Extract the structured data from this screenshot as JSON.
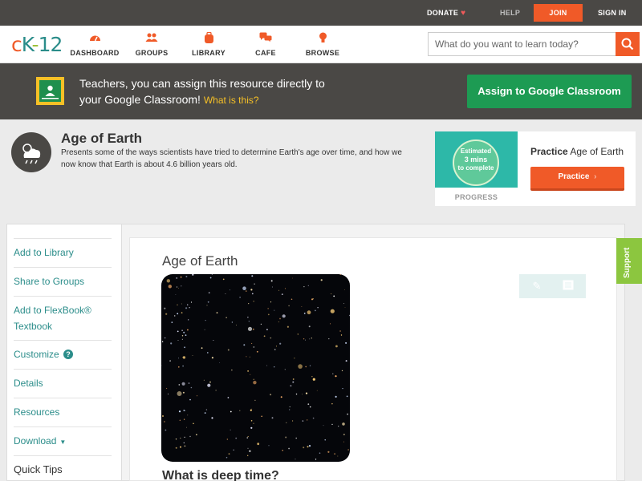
{
  "topbar": {
    "donate": "DONATE",
    "help": "HELP",
    "join": "JOIN",
    "sign_in": "SIGN IN"
  },
  "logo": {
    "c": "c",
    "k": "K",
    "dash": "-",
    "num": "12"
  },
  "nav": {
    "dashboard": "DASHBOARD",
    "groups": "GROUPS",
    "library": "LIBRARY",
    "cafe": "CAFE",
    "browse": "BROWSE"
  },
  "search": {
    "placeholder": "What do you want to learn today?"
  },
  "banner": {
    "line1": "Teachers, you can assign this resource directly to",
    "line2": "your Google Classroom!",
    "link": "What is this?",
    "button": "Assign to Google Classroom"
  },
  "concept": {
    "title": "Age of Earth",
    "description": "Presents some of the ways scientists have tried to determine Earth's age over time, and how we now know that Earth is about 4.6 billion years old."
  },
  "practice": {
    "estimated_line1": "Estimated",
    "estimated_line2": "3 mins",
    "estimated_line3": "to complete",
    "progress_label": "PROGRESS",
    "name_prefix": "Practice",
    "name": "Age of Earth",
    "button": "Practice"
  },
  "sidebar": {
    "items": [
      "Add to Library",
      "Share to Groups",
      "Add to FlexBook® Textbook",
      "Customize",
      "Details",
      "Resources",
      "Download",
      "Quick Tips"
    ]
  },
  "article": {
    "title": "Age of Earth",
    "section_heading": "What is deep time?"
  },
  "support": {
    "label": "Support"
  },
  "colors": {
    "accent_orange": "#f05a28",
    "teal": "#2b8d8a",
    "google_green": "#1d9b53",
    "dark_bar": "#4a4845",
    "support_green": "#8cc63f"
  }
}
